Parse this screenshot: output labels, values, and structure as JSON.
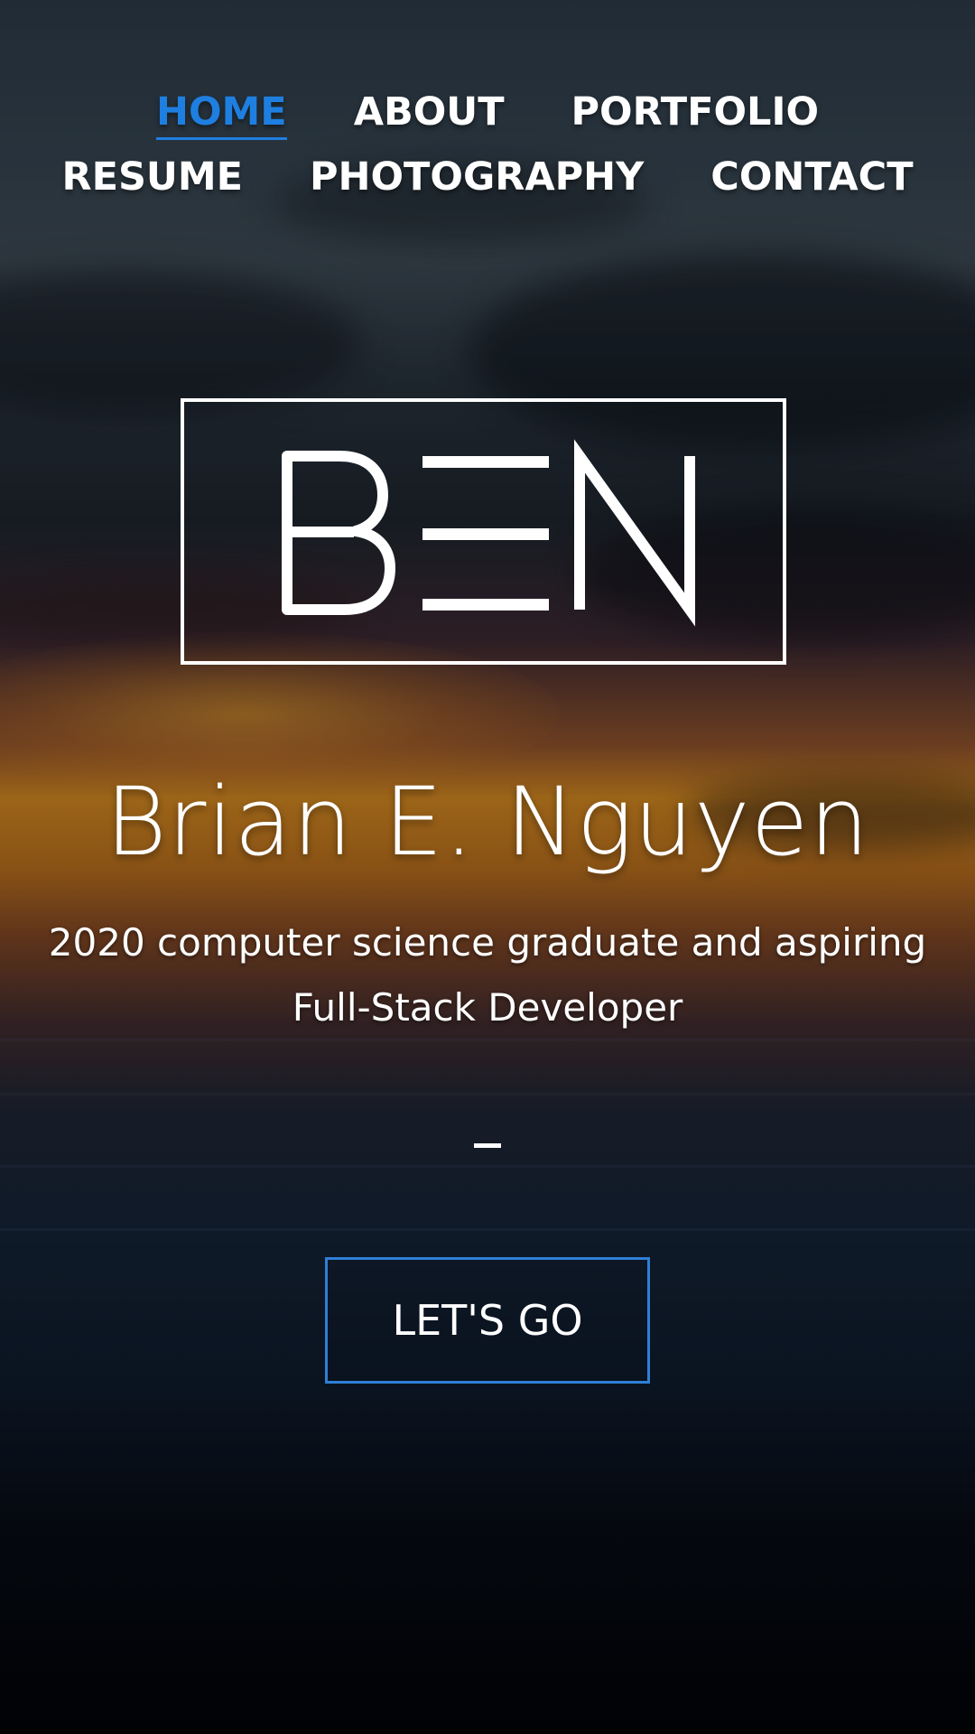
{
  "nav": {
    "row1": [
      "HOME",
      "ABOUT",
      "PORTFOLIO"
    ],
    "row2": [
      "RESUME",
      "PHOTOGRAPHY",
      "CONTACT"
    ],
    "active": "HOME"
  },
  "logo": {
    "text": "BEN"
  },
  "hero": {
    "name": "Brian E. Nguyen",
    "subtitle": "2020 computer science graduate and aspiring Full-Stack Developer"
  },
  "cta": {
    "label": "LET'S GO"
  },
  "colors": {
    "accent": "#1e7fe0",
    "button_border": "#2f7fd6",
    "text": "#ffffff"
  }
}
